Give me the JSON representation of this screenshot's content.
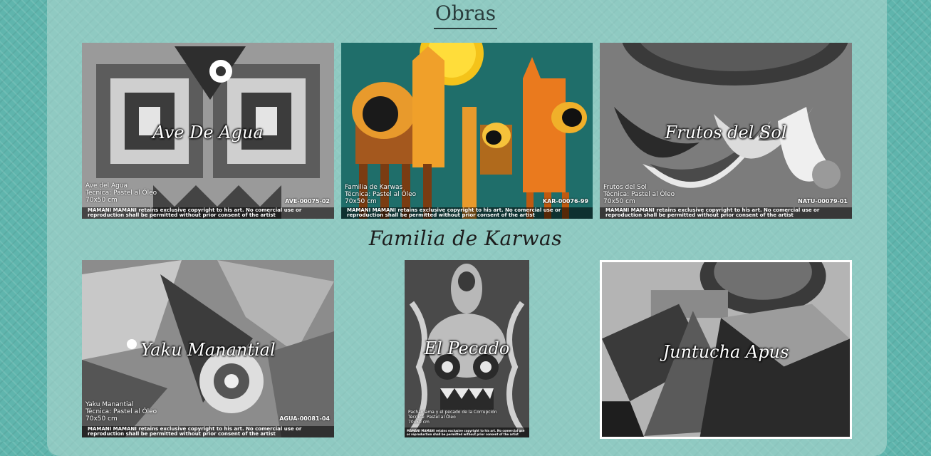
{
  "section": {
    "heading": "Obras",
    "subheading": "Familia de Karwas"
  },
  "artworks": [
    {
      "title": "Ave De Agua",
      "name": "Ave del Agua",
      "technique": "Técnica: Pastel al Óleo",
      "size": "70x50 cm",
      "code": "AVE-00075-02",
      "copyright": "MAMANI MAMANI retains exclusive copyright to his art. No comercial use or reproduction shall be permitted without prior consent of the artist"
    },
    {
      "title": "",
      "name": "Familia de Karwas",
      "technique": "Técnica: Pastel al Óleo",
      "size": "70x50 cm",
      "code": "KAR-00076-99",
      "copyright": "MAMANI MAMANI retains exclusive copyright to his art. No comercial use or reproduction shall be permitted without prior consent of the artist"
    },
    {
      "title": "Frutos del Sol",
      "name": "Frutos del Sol",
      "technique": "Técnica: Pastel al Óleo",
      "size": "70x50 cm",
      "code": "NATU-00079-01",
      "copyright": "MAMANI MAMANI retains exclusive copyright to his art. No comercial use or reproduction shall be permitted without prior consent of the artist"
    },
    {
      "title": "Yaku Manantial",
      "name": "Yaku Manantial",
      "technique": "Técnica: Pastel al Óleo",
      "size": "70x50 cm",
      "code": "AGUA-00081-04",
      "copyright": "MAMANI MAMANI retains exclusive copyright to his art. No comercial use or reproduction shall be permitted without prior consent of the artist"
    },
    {
      "title": "El Pecado",
      "name": "Pachamama y el pecado de la Corrupción",
      "technique": "Técnica: Pastel al Óleo",
      "size": "70x50 cm",
      "code": "",
      "copyright": "MAMANI MAMANI retains exclusive copyright to his art. No comercial use or reproduction shall be permitted without prior consent of the artist"
    },
    {
      "title": "Juntucha Apus",
      "name": "",
      "technique": "",
      "size": "",
      "code": "",
      "copyright": ""
    }
  ],
  "colors": {
    "background": "#5fb5ad",
    "panel": "#8fcac2",
    "heading_text": "#2a3c3c"
  }
}
